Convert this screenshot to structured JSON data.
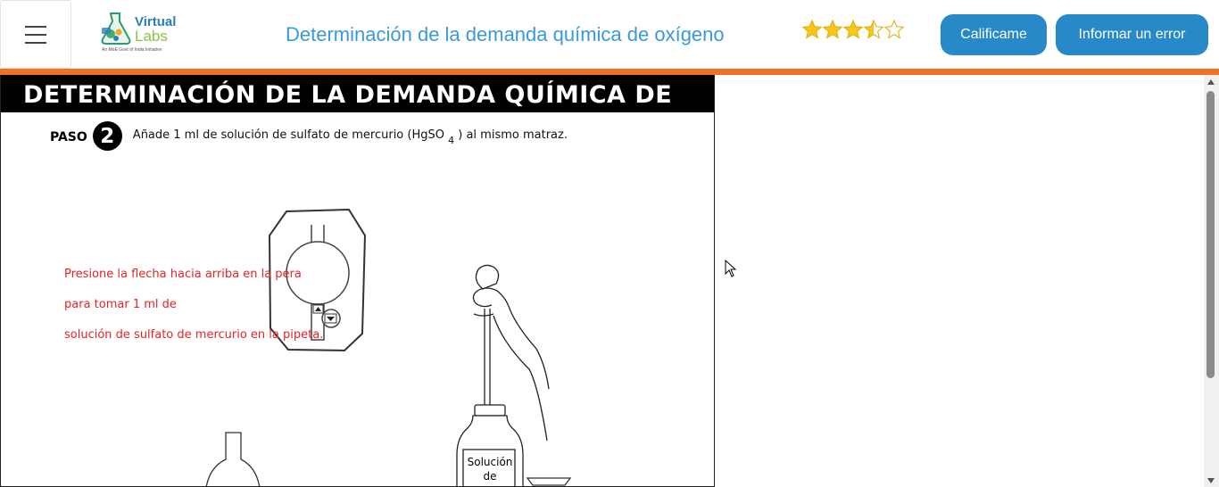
{
  "header": {
    "menu_icon": "hamburger-icon",
    "logo": {
      "word1": "Virtual",
      "word2": "Labs",
      "tagline": "An MoE Govt of India Initiative"
    },
    "title": "Determinación de la demanda química de oxígeno",
    "rating": {
      "value": 3.5,
      "max": 5,
      "color": "#f7c71b"
    },
    "rate_button": "Calificame",
    "report_button": "Informar un error",
    "accent_color": "#f27221",
    "button_color": "#2789c7"
  },
  "simulation": {
    "banner_title": "DETERMINACIÓN DE LA DEMANDA QUÍMICA DE",
    "step_label": "PASO",
    "step_number": "2",
    "step_text_before": "Añade 1 ml de solución de sulfato de mercurio (HgSO",
    "step_text_sub": "4",
    "step_text_after": ") al mismo matraz.",
    "instructions": [
      "Presione la flecha hacia arriba en la pera",
      "para tomar 1 ml de",
      "solución de sulfato de mercurio en la pipeta."
    ],
    "bottle_label_line1": "Solución",
    "bottle_label_line2": "de"
  },
  "scrollbar": {
    "up_icon": "scroll-up-arrow-icon",
    "down_icon": "scroll-down-arrow-icon"
  }
}
